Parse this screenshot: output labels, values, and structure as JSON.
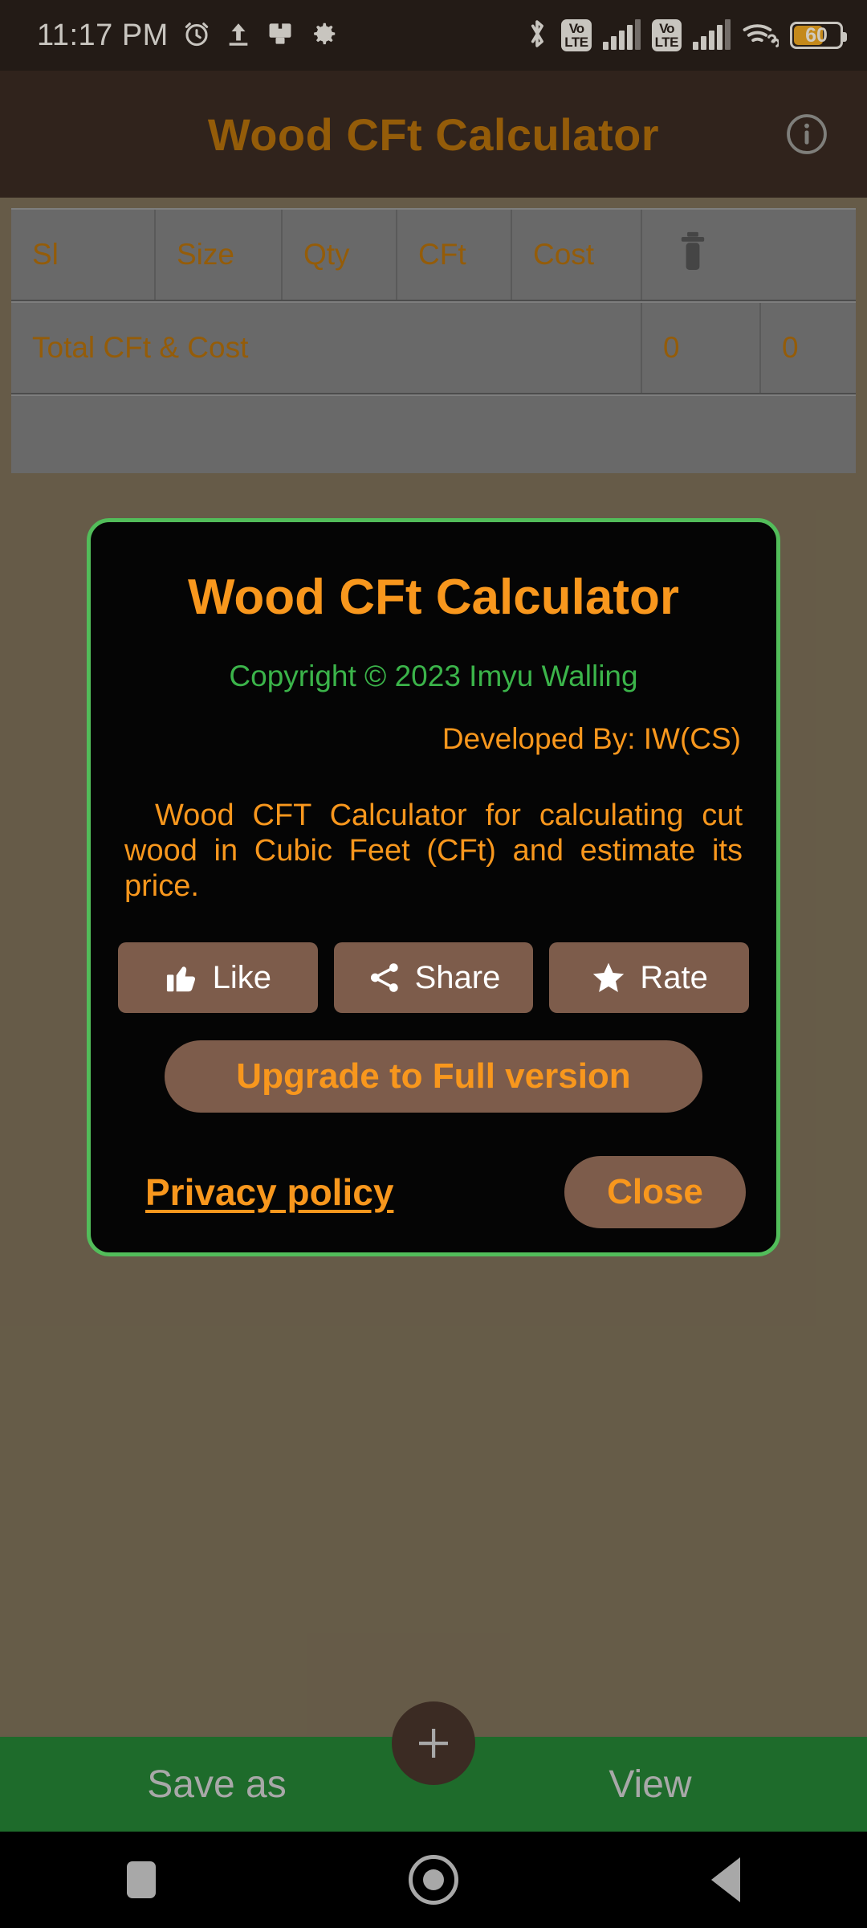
{
  "status_bar": {
    "clock": "11:17 PM",
    "icons": [
      "alarm-icon",
      "upload-icon",
      "screenshot-icon",
      "gear-icon",
      "bluetooth-icon",
      "volte-icon",
      "signal-icon",
      "volte-icon-2",
      "signal-icon-2",
      "wifi-icon",
      "battery-icon"
    ],
    "volte_top": "Vo",
    "volte_bottom": "LTE",
    "battery_level": "60"
  },
  "app_bar": {
    "title": "Wood CFt Calculator",
    "info_icon": "info-icon"
  },
  "table": {
    "headers": [
      "Sl",
      "Size",
      "Qty",
      "CFt",
      "Cost",
      ""
    ],
    "delete_icon": "trash-icon",
    "total_row": {
      "label": "Total CFt & Cost",
      "total_cft": "0",
      "total_cost": "0"
    }
  },
  "dialog": {
    "title": "Wood CFt Calculator",
    "copyright": "Copyright © 2023 Imyu Walling",
    "developer": "Developed By: IW(CS)",
    "description": "Wood CFT Calculator for calculating cut wood in Cubic Feet (CFt) and estimate its price.",
    "buttons": [
      {
        "label": "Like",
        "icon": "thumbs-up-icon"
      },
      {
        "label": "Share",
        "icon": "share-icon"
      },
      {
        "label": "Rate",
        "icon": "star-icon"
      }
    ],
    "upgrade_label": "Upgrade to Full version",
    "privacy_label": "Privacy policy",
    "close_label": "Close"
  },
  "bottom_bar": {
    "save_label": "Save as",
    "view_label": "View",
    "fab_icon": "plus-icon"
  },
  "nav_bar": {
    "recents_icon": "square-recents-icon",
    "home_icon": "circle-home-icon",
    "back_icon": "triangle-back-icon"
  },
  "colors": {
    "background": "#7d7058",
    "app_bar": "#3b2b23",
    "accent_orange": "#b5710b",
    "dialog_orange": "#f8971d",
    "dialog_border_green": "#52bd5a",
    "copyright_green": "#3bb44a",
    "bottom_bar_green": "#1e6b2b",
    "table_gray": "#808080",
    "button_brown": "#7d5c4b"
  }
}
